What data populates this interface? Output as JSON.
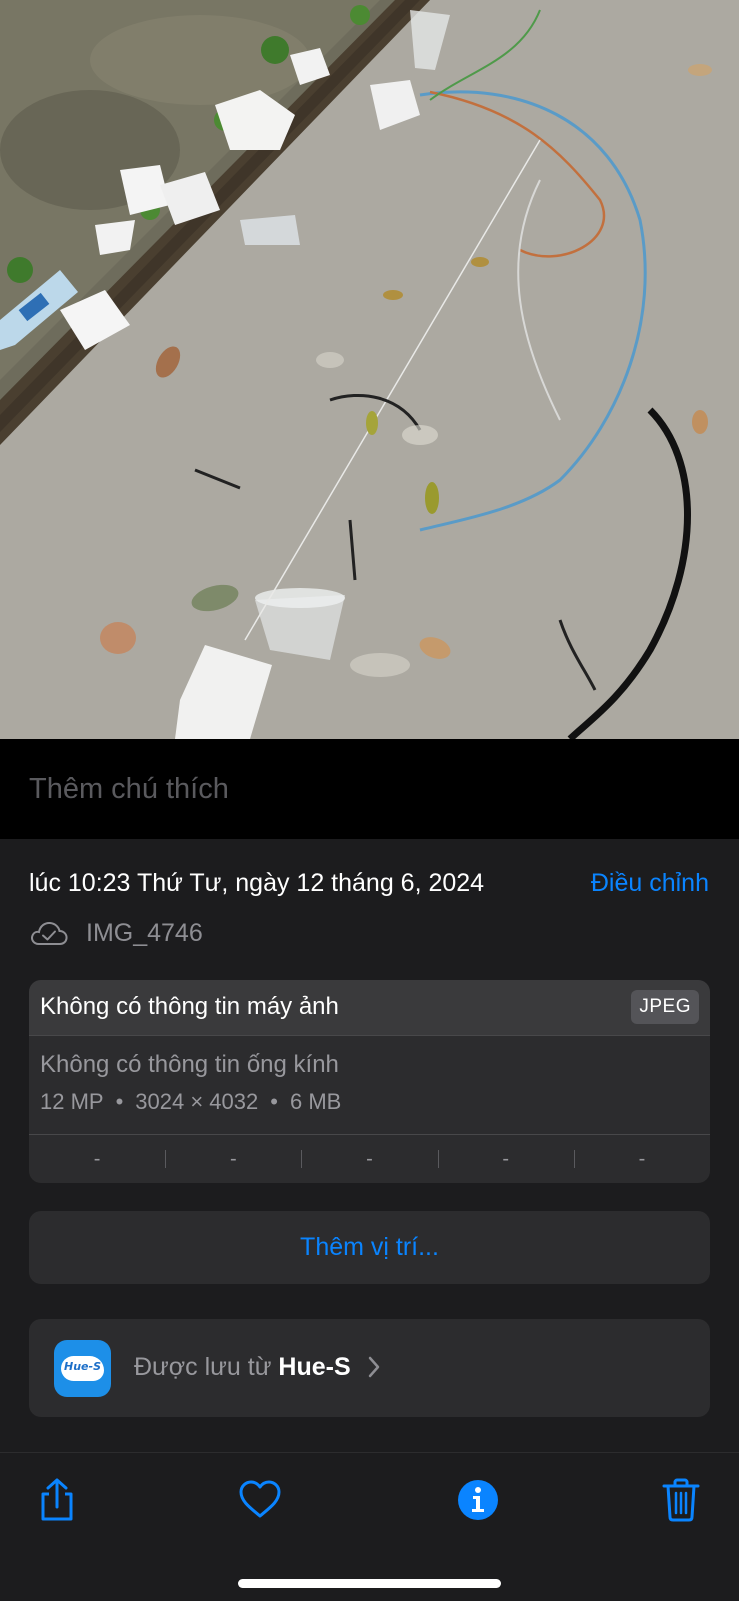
{
  "caption": {
    "placeholder": "Thêm chú thích"
  },
  "info": {
    "date": "lúc 10:23 Thứ Tư, ngày 12 tháng 6, 2024",
    "adjust_label": "Điều chỉnh",
    "file_name": "IMG_4746"
  },
  "camera": {
    "title": "Không có thông tin máy ảnh",
    "format": "JPEG",
    "lens": "Không có thông tin ống kính",
    "megapixels": "12 MP",
    "resolution": "3024 × 4032",
    "size": "6 MB",
    "separator": "•",
    "exif": [
      "-",
      "-",
      "-",
      "-",
      "-"
    ]
  },
  "location": {
    "label": "Thêm vị trí..."
  },
  "source": {
    "prefix": "Được lưu từ ",
    "app": "Hue-S",
    "icon_text": "Hue-S"
  },
  "colors": {
    "accent": "#0a84ff",
    "panel": "#1c1c1e",
    "card": "#2c2c2e"
  },
  "icons": [
    "cloud-icon",
    "share-icon",
    "heart-icon",
    "info-icon",
    "trash-icon",
    "chevron-right-icon"
  ]
}
